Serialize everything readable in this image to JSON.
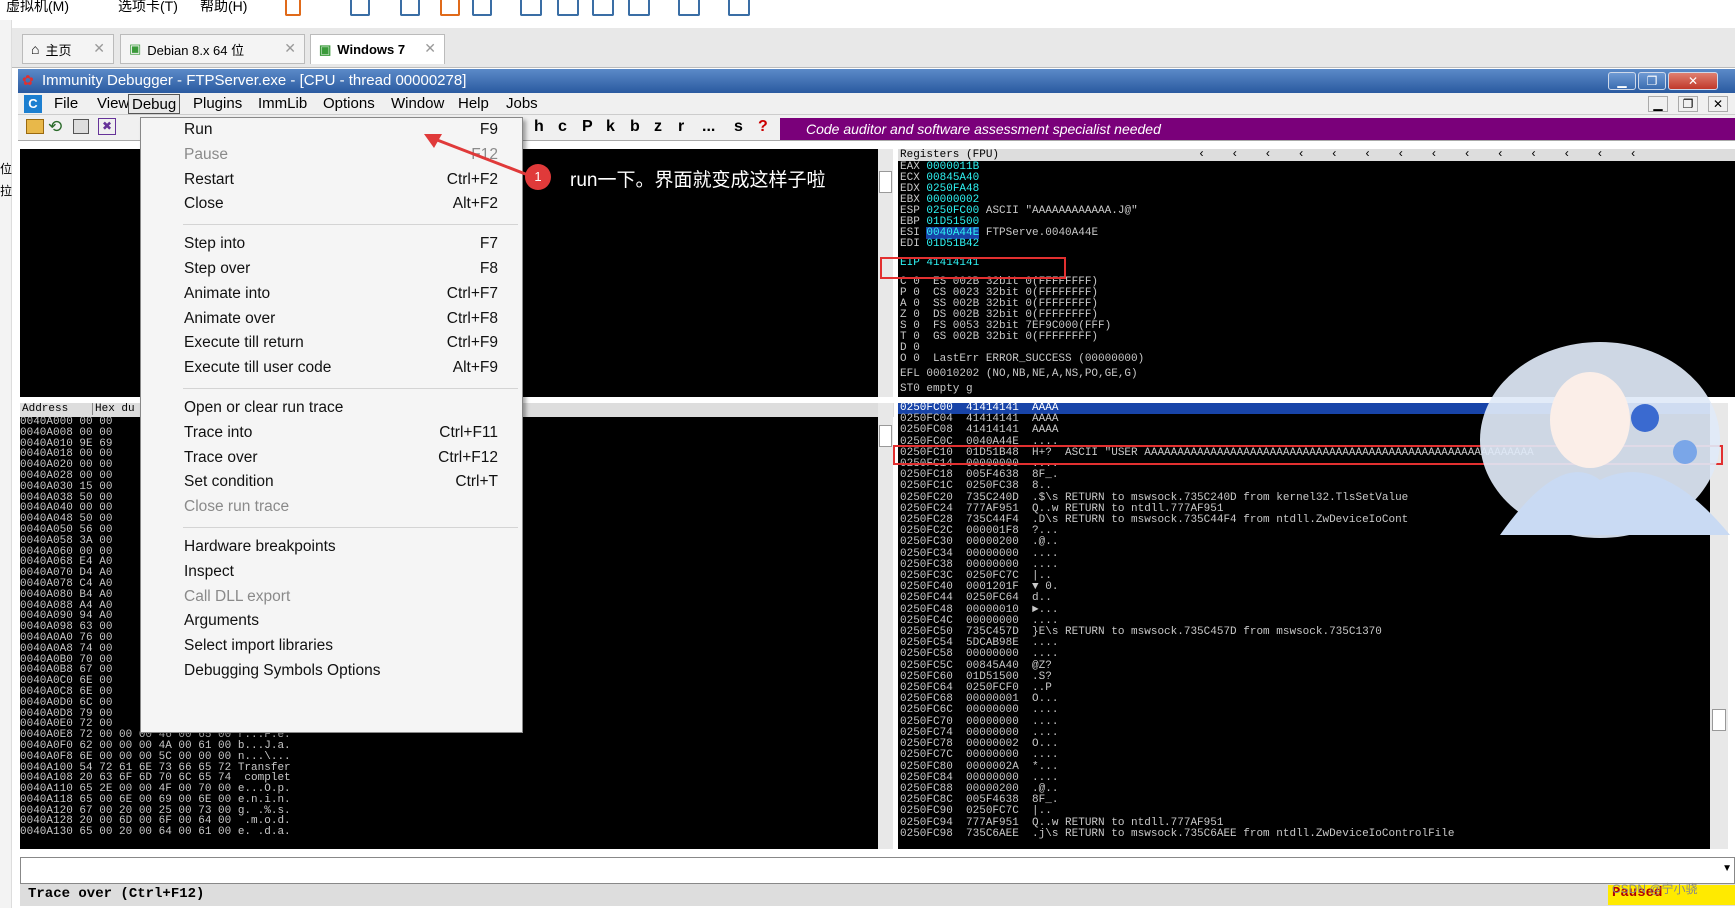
{
  "vm_menu": [
    "虚拟机(M)",
    "选项卡(T)",
    "帮助(H)"
  ],
  "vm_tabs": [
    {
      "label": "主页",
      "active": false
    },
    {
      "label": "Debian 8.x 64 位",
      "active": false
    },
    {
      "label": "Windows 7",
      "active": true
    }
  ],
  "window": {
    "title": "Immunity Debugger - FTPServer.exe - [CPU - thread 00000278]"
  },
  "app_menu": [
    "File",
    "View",
    "Debug",
    "Plugins",
    "ImmLib",
    "Options",
    "Window",
    "Help",
    "Jobs"
  ],
  "app_menu_active": "Debug",
  "toolbar_letters": [
    "h",
    "c",
    "P",
    "k",
    "b",
    "z",
    "r",
    "...",
    "s",
    "?"
  ],
  "banner": "Code auditor and software assessment specialist needed",
  "debug_menu": [
    {
      "label": "Run",
      "key": "F9",
      "disabled": false
    },
    {
      "label": "Pause",
      "key": "F12",
      "disabled": true
    },
    {
      "label": "Restart",
      "key": "Ctrl+F2",
      "disabled": false
    },
    {
      "label": "Close",
      "key": "Alt+F2",
      "disabled": false
    },
    {
      "sep": true
    },
    {
      "label": "Step into",
      "key": "F7",
      "disabled": false
    },
    {
      "label": "Step over",
      "key": "F8",
      "disabled": false
    },
    {
      "label": "Animate into",
      "key": "Ctrl+F7",
      "disabled": false
    },
    {
      "label": "Animate over",
      "key": "Ctrl+F8",
      "disabled": false
    },
    {
      "label": "Execute till return",
      "key": "Ctrl+F9",
      "disabled": false
    },
    {
      "label": "Execute till user code",
      "key": "Alt+F9",
      "disabled": false
    },
    {
      "sep": true
    },
    {
      "label": "Open or clear run trace",
      "key": "",
      "disabled": false
    },
    {
      "label": "Trace into",
      "key": "Ctrl+F11",
      "disabled": false
    },
    {
      "label": "Trace over",
      "key": "Ctrl+F12",
      "disabled": false
    },
    {
      "label": "Set condition",
      "key": "Ctrl+T",
      "disabled": false
    },
    {
      "label": "Close run trace",
      "key": "",
      "disabled": true
    },
    {
      "sep": true
    },
    {
      "label": "Hardware breakpoints",
      "key": "",
      "disabled": false
    },
    {
      "label": "Inspect",
      "key": "",
      "disabled": false
    },
    {
      "label": "Call DLL export",
      "key": "",
      "disabled": true
    },
    {
      "label": "Arguments",
      "key": "",
      "disabled": false
    },
    {
      "label": "Select import libraries",
      "key": "",
      "disabled": false
    },
    {
      "label": "Debugging Symbols Options",
      "key": "",
      "disabled": false
    }
  ],
  "annotation": {
    "badge": "1",
    "text": "run一下。界面就变成这样子啦"
  },
  "dump_header": {
    "address": "Address",
    "hex": "Hex du"
  },
  "dump_rows": [
    "0040A000 00 00",
    "0040A008 00 00",
    "0040A010 9E 69",
    "0040A018 00 00",
    "0040A020 00 00",
    "0040A028 00 00",
    "0040A030 15 00",
    "0040A038 50 00",
    "0040A040 00 00",
    "0040A048 50 00",
    "0040A050 56 00",
    "0040A058 3A 00",
    "0040A060 00 00",
    "0040A068 E4 A0",
    "0040A070 D4 A0",
    "0040A078 C4 A0",
    "0040A080 B4 A0",
    "0040A088 A4 A0",
    "0040A090 94 A0",
    "0040A098 63 00",
    "0040A0A0 76 00",
    "0040A0A8 74 00",
    "0040A0B0 70 00",
    "0040A0B8 67 00",
    "0040A0C0 6E 00",
    "0040A0C8 6E 00",
    "0040A0D0 6C 00",
    "0040A0D8 79 00",
    "0040A0E0 72 00",
    "0040A0E8 72 00 00 00 46 00 65 00 r...F.e.",
    "0040A0F0 62 00 00 00 4A 00 61 00 b...J.a.",
    "0040A0F8 6E 00 00 00 5C 00 00 00 n...\\...",
    "0040A100 54 72 61 6E 73 66 65 72 Transfer",
    "0040A108 20 63 6F 6D 70 6C 65 74  complet",
    "0040A110 65 2E 00 00 4F 00 70 00 e...O.p.",
    "0040A118 65 00 6E 00 69 00 6E 00 e.n.i.n.",
    "0040A120 67 00 20 00 25 00 73 00 g. .%.s.",
    "0040A128 20 00 6D 00 6F 00 64 00  .m.o.d.",
    "0040A130 65 00 20 00 64 00 61 00 e. .d.a."
  ],
  "registers": {
    "header": "Registers (FPU)",
    "rows": [
      {
        "name": "EAX",
        "value": "0000011B",
        "comment": ""
      },
      {
        "name": "ECX",
        "value": "00845A40",
        "comment": ""
      },
      {
        "name": "EDX",
        "value": "0250FA48",
        "comment": ""
      },
      {
        "name": "EBX",
        "value": "00000002",
        "comment": ""
      },
      {
        "name": "ESP",
        "value": "0250FC00",
        "comment": "ASCII \"AAAAAAAAAAAA.J@\""
      },
      {
        "name": "EBP",
        "value": "01D51500",
        "comment": ""
      },
      {
        "name": "ESI",
        "value": "0040A44E",
        "comment": "FTPServe.0040A44E"
      },
      {
        "name": "EDI",
        "value": "01D51B42",
        "comment": ""
      }
    ],
    "eip": "EIP 41414141",
    "segs": [
      "C 0  ES 002B 32bit 0(FFFFFFFF)",
      "P 0  CS 0023 32bit 0(FFFFFFFF)",
      "A 0  SS 002B 32bit 0(FFFFFFFF)",
      "Z 0  DS 002B 32bit 0(FFFFFFFF)",
      "S 0  FS 0053 32bit 7EF9C000(FFF)",
      "T 0  GS 002B 32bit 0(FFFFFFFF)",
      "D 0",
      "O 0  LastErr ERROR_SUCCESS (00000000)"
    ],
    "efl": "EFL 00010202 (NO,NB,NE,A,NS,PO,GE,G)",
    "st0": "ST0 empty g"
  },
  "stack_rows": [
    "0250FC00  41414141  AAAA",
    "0250FC04  41414141  AAAA",
    "0250FC08  41414141  AAAA",
    "0250FC0C  0040A44E  ....",
    "0250FC10  01D51B48  H+?  ASCII \"USER AAAAAAAAAAAAAAAAAAAAAAAAAAAAAAAAAAAAAAAAAAAAAAAAAAAAAAAAAAA",
    "0250FC14  00000000  ....",
    "0250FC18  005F4638  8F_.",
    "0250FC1C  0250FC38  8..",
    "0250FC20  735C240D  .$\\s RETURN to mswsock.735C240D from kernel32.TlsSetValue",
    "0250FC24  777AF951  Q..w RETURN to ntdll.777AF951",
    "0250FC28  735C44F4  .D\\s RETURN to mswsock.735C44F4 from ntdll.ZwDeviceIoCont",
    "0250FC2C  000001F8  ?...",
    "0250FC30  00000200  .@..",
    "0250FC34  00000000  ....",
    "0250FC38  00000000  ....",
    "0250FC3C  0250FC7C  |..",
    "0250FC40  0001201F  ▼ 0.",
    "0250FC44  0250FC64  d..",
    "0250FC48  00000010  ►...",
    "0250FC4C  00000000  ....",
    "0250FC50  735C457D  }E\\s RETURN to mswsock.735C457D from mswsock.735C1370",
    "0250FC54  5DCAB98E  ....",
    "0250FC58  00000000  ....",
    "0250FC5C  00845A40  @Z?",
    "0250FC60  01D51500  .S?",
    "0250FC64  0250FCF0  ..P",
    "0250FC68  00000001  O...",
    "0250FC6C  00000000  ....",
    "0250FC70  00000000  ....",
    "0250FC74  00000000  ....",
    "0250FC78  00000002  O...",
    "0250FC7C  00000000  ....",
    "0250FC80  0000002A  *...",
    "0250FC84  00000000  ....",
    "0250FC88  00000200  .@..",
    "0250FC8C  005F4638  8F_.",
    "0250FC90  0250FC7C  |..",
    "0250FC94  777AF951  Q..w RETURN to ntdll.777AF951",
    "0250FC98  735C6AEE  .j\\s RETURN to mswsock.735C6AEE from ntdll.ZwDeviceIoControlFile"
  ],
  "status": {
    "text": "Trace over (Ctrl+F12)",
    "state": "Paused",
    "watermark": "CSDN @宁小骁"
  },
  "left_strip_chars": [
    "位",
    "拉"
  ],
  "colors": {
    "title_bar": "#2a5aa0",
    "banner": "#7a007a",
    "annotation_red": "#e03a3a",
    "status_paused_bg": "#ffea00"
  }
}
